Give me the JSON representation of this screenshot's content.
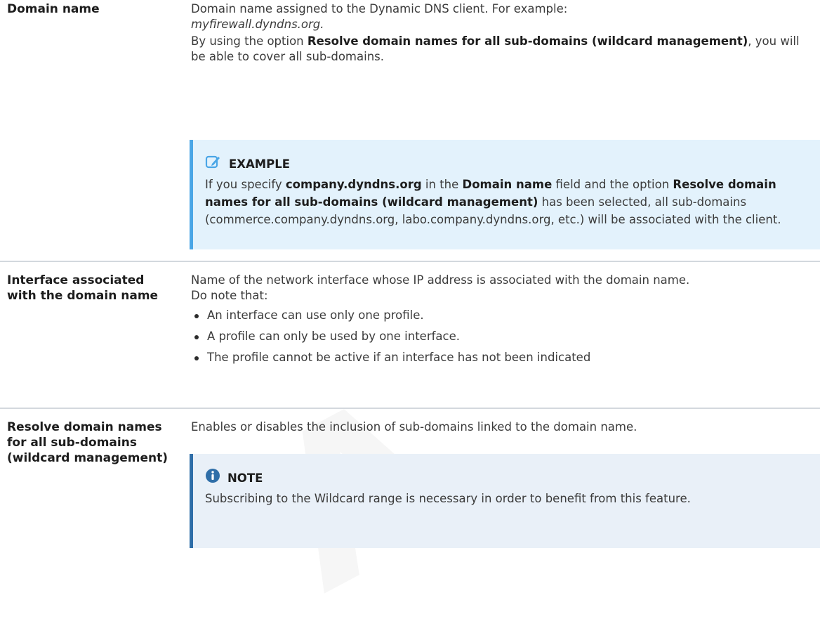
{
  "watermark": "A",
  "rows": [
    {
      "label": "Domain name",
      "desc_line1": "Domain name assigned to the Dynamic DNS client. For example:",
      "desc_example": "myfirewall.dyndns.org.",
      "desc_p2_pre": "By using the option ",
      "desc_p2_bold": "Resolve domain names for all sub-domains (wildcard management)",
      "desc_p2_post": ", you will be able to cover all sub-domains.",
      "callout": {
        "title": "EXAMPLE",
        "icon": "pencil-edit-icon",
        "t1": "If you specify ",
        "b1": "company.dyndns.org",
        "t2": " in the ",
        "b2": "Domain name",
        "t3": " field and the option ",
        "b3": "Resolve domain names for all sub-domains (wildcard management)",
        "t4": " has been selected, all sub-domains (commerce.company.dyndns.org, labo.company.dyndns.org, etc.) will be associated with the client."
      }
    },
    {
      "label": "Interface associated with the domain name",
      "desc": "Name of the network interface whose IP address is associated with the domain name.",
      "note_intro": "Do note that:",
      "bullets": [
        "An interface can use only one profile.",
        "A profile can only be used by one interface.",
        "The profile cannot be active if an interface has not been indicated"
      ]
    },
    {
      "label": "Resolve domain names for all sub-domains (wildcard management)",
      "desc": "Enables or disables the inclusion of sub-domains linked to the domain name.",
      "callout": {
        "title": "NOTE",
        "icon": "info-icon",
        "text": "Subscribing to the Wildcard range is necessary in order to benefit from this feature."
      }
    }
  ],
  "colors": {
    "example_bg": "#e3f2fc",
    "example_border": "#4aa6e6",
    "note_bg": "#e9f0f8",
    "note_border": "#2f6ea8",
    "separator": "#d3d8de"
  }
}
